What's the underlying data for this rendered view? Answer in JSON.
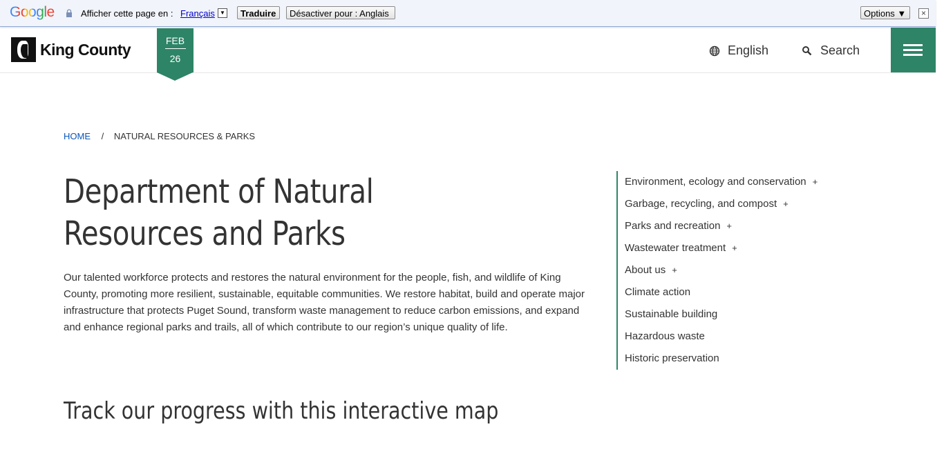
{
  "translate_bar": {
    "logo": "Google",
    "prompt": "Afficher cette page en :",
    "language": "Français",
    "translate_button": "Traduire",
    "disable_button": "Désactiver pour : Anglais",
    "options_button": "Options ▼",
    "close_symbol": "×"
  },
  "header": {
    "logo_text": "King County",
    "date_month": "FEB",
    "date_day": "26",
    "language_label": "English",
    "search_label": "Search"
  },
  "breadcrumb": {
    "home": "HOME",
    "separator": "/",
    "current": "NATURAL RESOURCES & PARKS"
  },
  "main": {
    "title": "Department of Natural Resources and Parks",
    "intro": "Our talented workforce protects and restores the natural environment for the people, fish, and wildlife of King County, promoting more resilient, sustainable, equitable communities. We restore habitat, build and operate major infrastructure that protects Puget Sound, transform waste management to reduce carbon emissions, and expand and enhance regional parks and trails, all of which contribute to our region’s unique quality of life.",
    "subheading": "Track our progress with this interactive map"
  },
  "side_nav": [
    {
      "label": "Environment, ecology and conservation",
      "expand": "+"
    },
    {
      "label": "Garbage, recycling, and compost",
      "expand": "+"
    },
    {
      "label": "Parks and recreation",
      "expand": "+"
    },
    {
      "label": "Wastewater treatment",
      "expand": "+"
    },
    {
      "label": "About us",
      "expand": "+"
    },
    {
      "label": "Climate action",
      "expand": ""
    },
    {
      "label": "Sustainable building",
      "expand": ""
    },
    {
      "label": "Hazardous waste",
      "expand": ""
    },
    {
      "label": "Historic preservation",
      "expand": ""
    }
  ],
  "colors": {
    "accent": "#2e8466",
    "link": "#0a55b7",
    "google_blue": "#4285f4",
    "google_red": "#ea4335",
    "google_yellow": "#fbbc05",
    "google_green": "#34a853"
  }
}
